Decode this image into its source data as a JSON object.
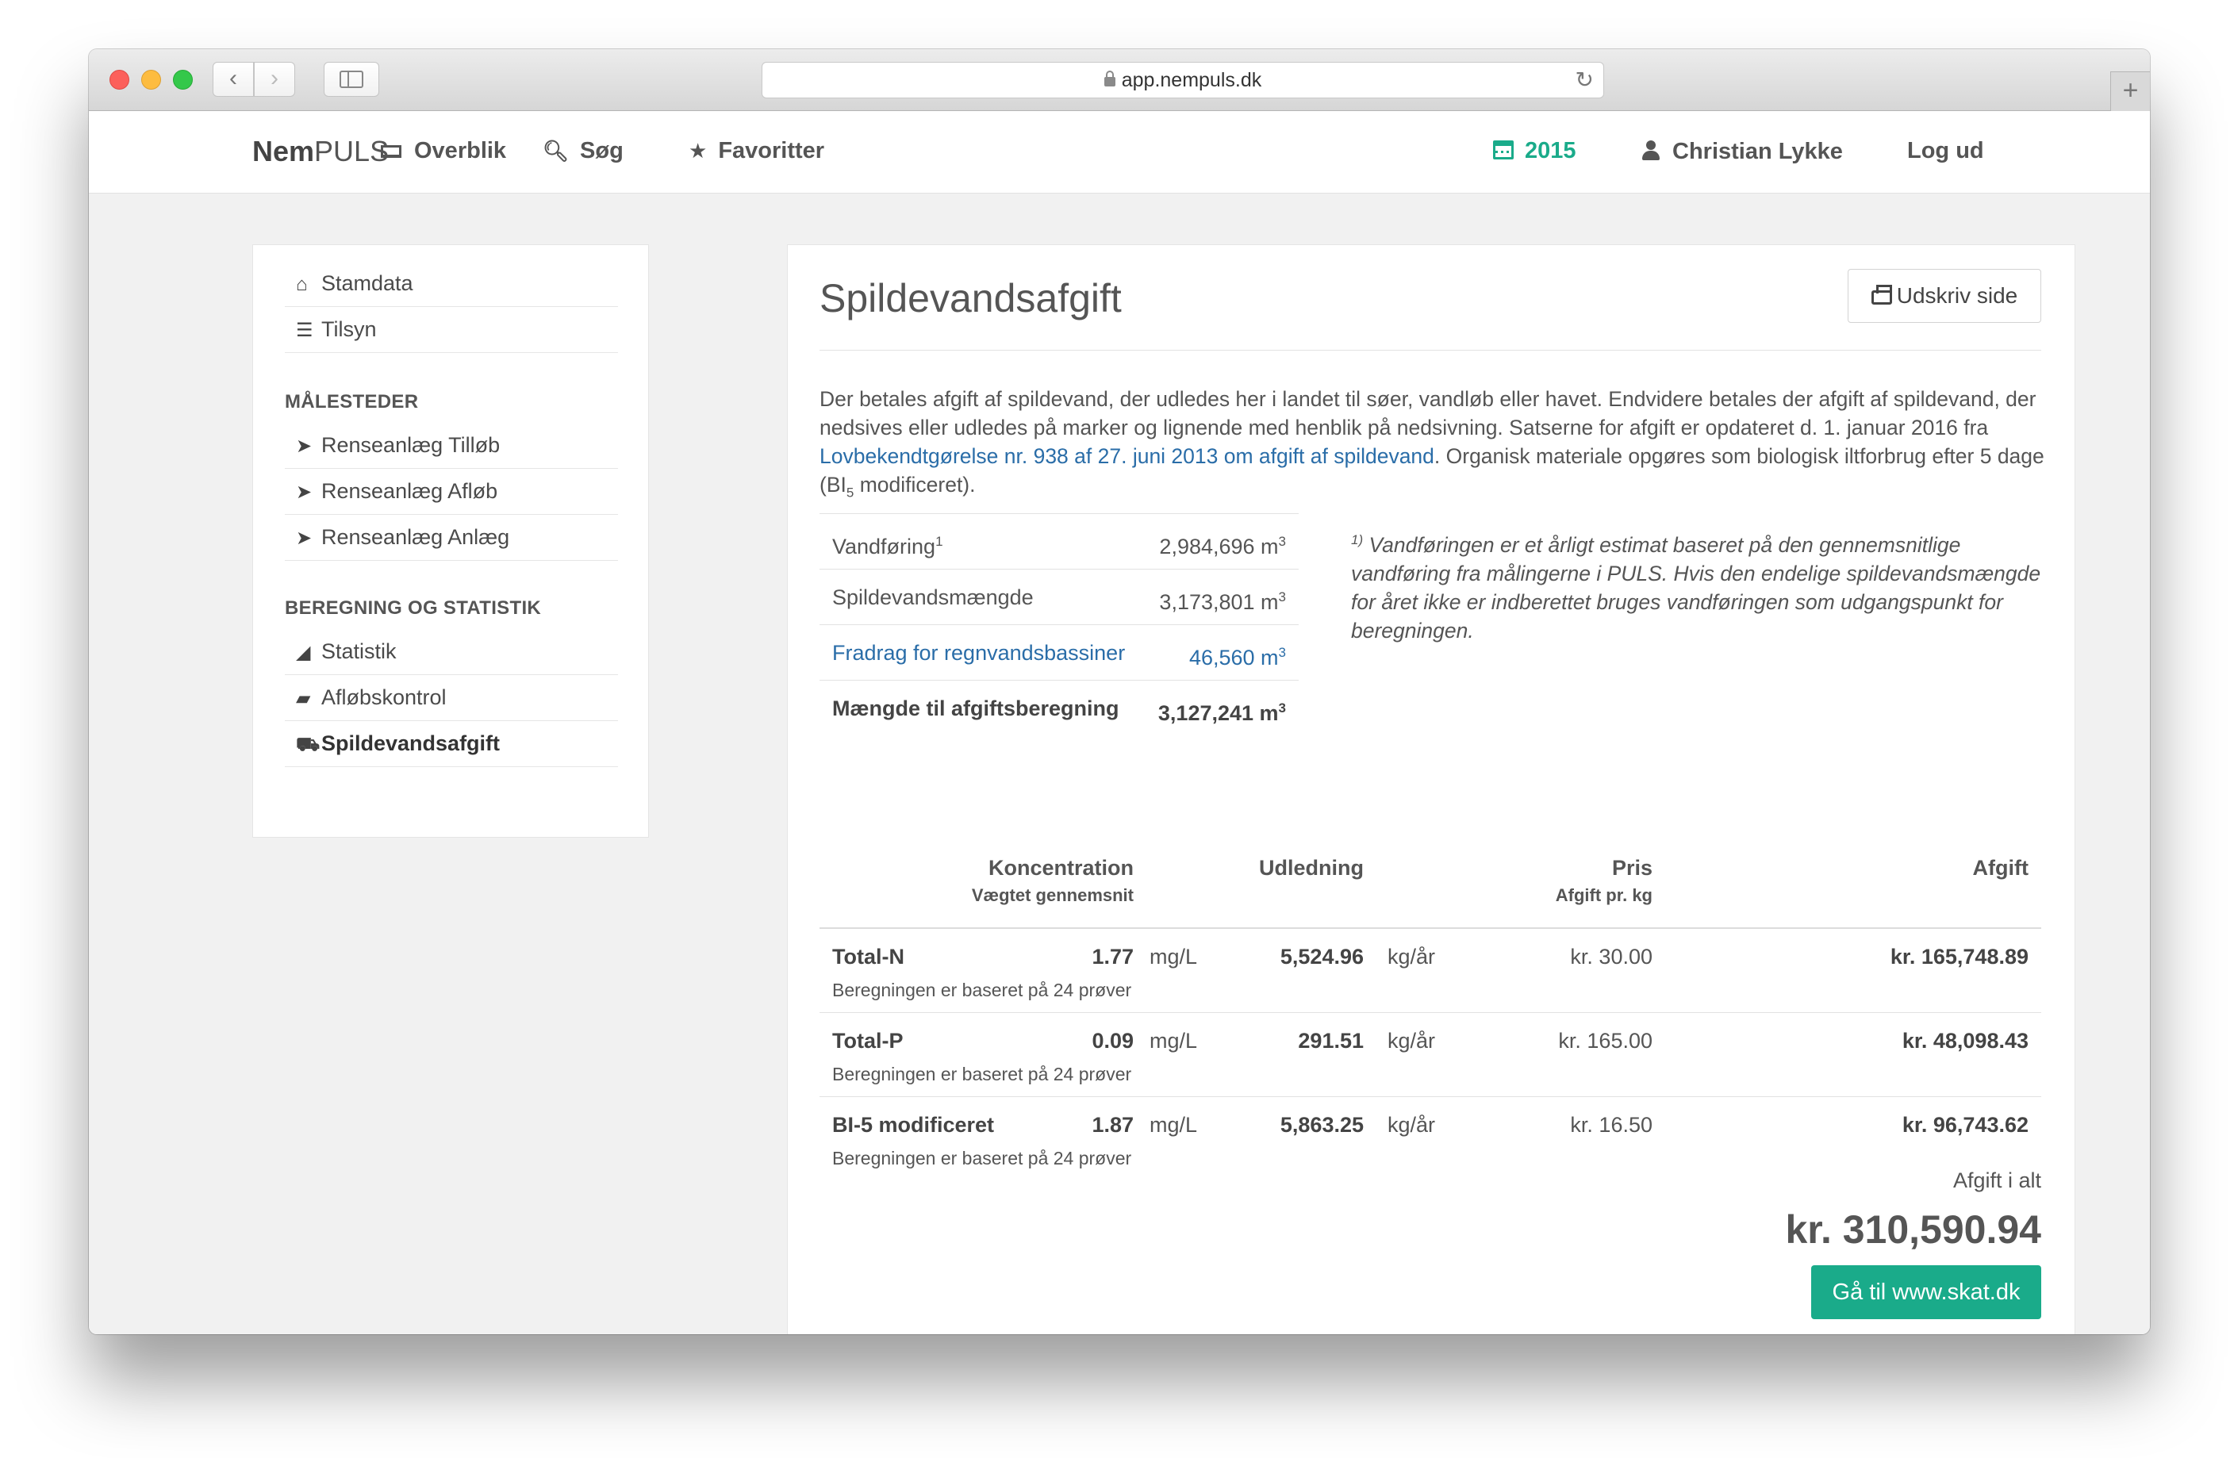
{
  "browser": {
    "url": "app.nempuls.dk"
  },
  "navbar": {
    "brand_bold": "Nem",
    "brand_rest": "PULS",
    "overview": "Overblik",
    "search": "Søg",
    "favorites": "Favoritter",
    "year": "2015",
    "user": "Christian Lykke",
    "logout": "Log ud",
    "accent_color": "#1aab8a"
  },
  "sidebar": {
    "top_items": [
      {
        "label": "Stamdata",
        "icon": "home-icon"
      },
      {
        "label": "Tilsyn",
        "icon": "list-icon"
      }
    ],
    "section1_title": "MÅLESTEDER",
    "section1_items": [
      {
        "label": "Renseanlæg Tilløb",
        "icon": "location-arrow-icon"
      },
      {
        "label": "Renseanlæg Afløb",
        "icon": "location-arrow-icon"
      },
      {
        "label": "Renseanlæg Anlæg",
        "icon": "location-arrow-icon"
      }
    ],
    "section2_title": "BEREGNING OG STATISTIK",
    "section2_items": [
      {
        "label": "Statistik",
        "icon": "area-chart-icon"
      },
      {
        "label": "Afløbskontrol",
        "icon": "truck-icon"
      },
      {
        "label": "Spildevandsafgift",
        "icon": "cart-icon",
        "active": true
      }
    ]
  },
  "main": {
    "title": "Spildevandsafgift",
    "print_button": "Udskriv side",
    "intro_part1": "Der betales afgift af spildevand, der udledes her i landet til søer, vandløb eller havet. Endvidere betales der afgift af spildevand, der nedsives eller udledes på marker og lignende med henblik på nedsivning. Satserne for afgift er opdateret d. 1. januar 2016 fra ",
    "intro_link": "Lovbekendtgørelse nr. 938 af 27. juni 2013 om afgift af spildevand",
    "intro_part2": ". Organisk materiale opgøres som biologisk iltforbrug efter 5 dage (BI",
    "intro_sub": "5",
    "intro_part3": " modificeret).",
    "volumes": [
      {
        "label": "Vandføring",
        "sup": "1",
        "value": "2,984,696 m",
        "unit_sup": "3"
      },
      {
        "label": "Spildevandsmængde",
        "sup": "",
        "value": "3,173,801 m",
        "unit_sup": "3"
      },
      {
        "label": "Fradrag for regnvandsbassiner",
        "sup": "",
        "value": "46,560 m",
        "unit_sup": "3"
      },
      {
        "label": "Mængde til afgiftsberegning",
        "sup": "",
        "value": "3,127,241 m",
        "unit_sup": "3"
      }
    ],
    "footnote_sup": "1)",
    "footnote_text": " Vandføringen er et årligt estimat baseret på den gennemsnitlige vandføring fra målingerne i PULS. Hvis den endelige spildevandsmængde for året ikke er indberettet bruges vandføringen som udgangspunkt for beregningen.",
    "fee_headers": {
      "concentration": "Koncentration",
      "concentration_sub": "Vægtet gennemsnit",
      "discharge": "Udledning",
      "price": "Pris",
      "price_sub": "Afgift pr. kg",
      "fee": "Afgift"
    },
    "fees": [
      {
        "name": "Total-N",
        "note": "Beregningen er baseret på 24 prøver",
        "conc": "1.77",
        "conc_unit": "mg/L",
        "discharge": "5,524.96",
        "discharge_unit": "kg/år",
        "price": "kr. 30.00",
        "fee": "kr. 165,748.89"
      },
      {
        "name": "Total-P",
        "note": "Beregningen er baseret på 24 prøver",
        "conc": "0.09",
        "conc_unit": "mg/L",
        "discharge": "291.51",
        "discharge_unit": "kg/år",
        "price": "kr. 165.00",
        "fee": "kr. 48,098.43"
      },
      {
        "name": "BI-5 modificeret",
        "note": "Beregningen er baseret på 24 prøver",
        "conc": "1.87",
        "conc_unit": "mg/L",
        "discharge": "5,863.25",
        "discharge_unit": "kg/år",
        "price": "kr. 16.50",
        "fee": "kr. 96,743.62"
      }
    ],
    "total_label": "Afgift i alt",
    "total_value": "kr. 310,590.94",
    "skat_button": "Gå til www.skat.dk"
  }
}
